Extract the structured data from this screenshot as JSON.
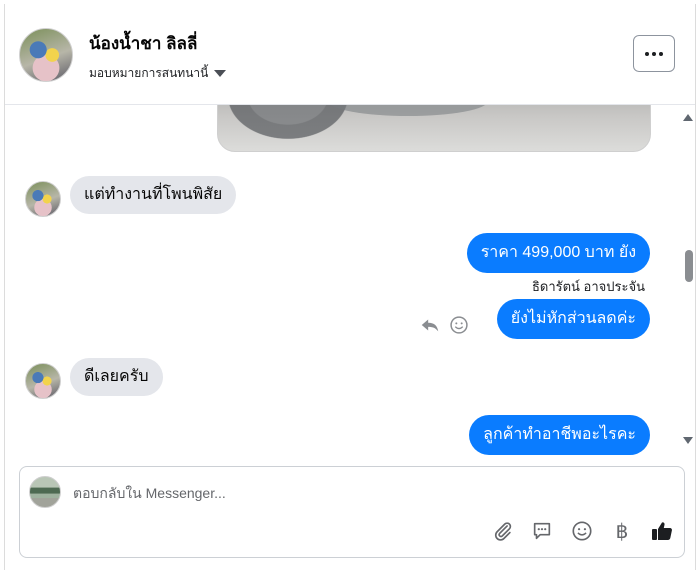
{
  "header": {
    "contact_name": "น้องน้ำชา ลิลลี่",
    "assign_label": "มอบหมายการสนทนานี้",
    "more_icon": "more-horizontal-icon"
  },
  "messages": [
    {
      "direction": "incoming",
      "text": "แต่ทำงานที่โพนพิสัย"
    },
    {
      "direction": "outgoing",
      "text": "ราคา 499,000 บาท ยัง"
    },
    {
      "direction": "outgoing",
      "sender": "ธิดารัตน์ อาจประจัน",
      "text": "ยังไม่หักส่วนลดค่ะ"
    },
    {
      "direction": "incoming",
      "text": "ดีเลยครับ"
    },
    {
      "direction": "outgoing",
      "text": "ลูกค้าทำอาชีพอะไรคะ"
    }
  ],
  "composer": {
    "placeholder": "ตอบกลับใน Messenger...",
    "value": "",
    "currency_symbol": "฿",
    "tools": [
      "paperclip-icon",
      "saved-reply-icon",
      "emoji-icon",
      "baht-icon",
      "thumbs-up-icon"
    ]
  },
  "colors": {
    "outgoing_bubble": "#0a7cff",
    "incoming_bubble": "#e4e6eb"
  }
}
